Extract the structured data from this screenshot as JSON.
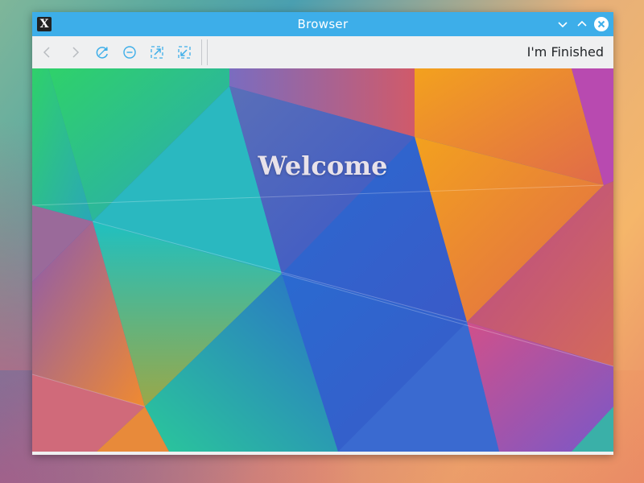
{
  "window": {
    "title": "Browser",
    "app_icon_glyph": "X",
    "controls": {
      "minimize_icon": "chevron-down-icon",
      "maximize_icon": "chevron-up-icon",
      "close_icon": "close-icon"
    }
  },
  "toolbar": {
    "buttons": [
      {
        "name": "back-button",
        "icon": "chevron-left-icon"
      },
      {
        "name": "forward-button",
        "icon": "chevron-right-icon"
      },
      {
        "name": "reload-button",
        "icon": "reload-icon"
      },
      {
        "name": "zoom-out-button",
        "icon": "zoom-out-icon"
      },
      {
        "name": "fullscreen-button",
        "icon": "expand-icon"
      },
      {
        "name": "restore-button",
        "icon": "shrink-icon"
      }
    ],
    "finished_label": "I'm Finished"
  },
  "page": {
    "heading": "Welcome"
  },
  "colors": {
    "titlebar": "#3daee9",
    "toolbar": "#eff0f1",
    "icon": "#3daee9",
    "icon_disabled": "#b8bcc0",
    "heading": "#e8e2ea"
  }
}
